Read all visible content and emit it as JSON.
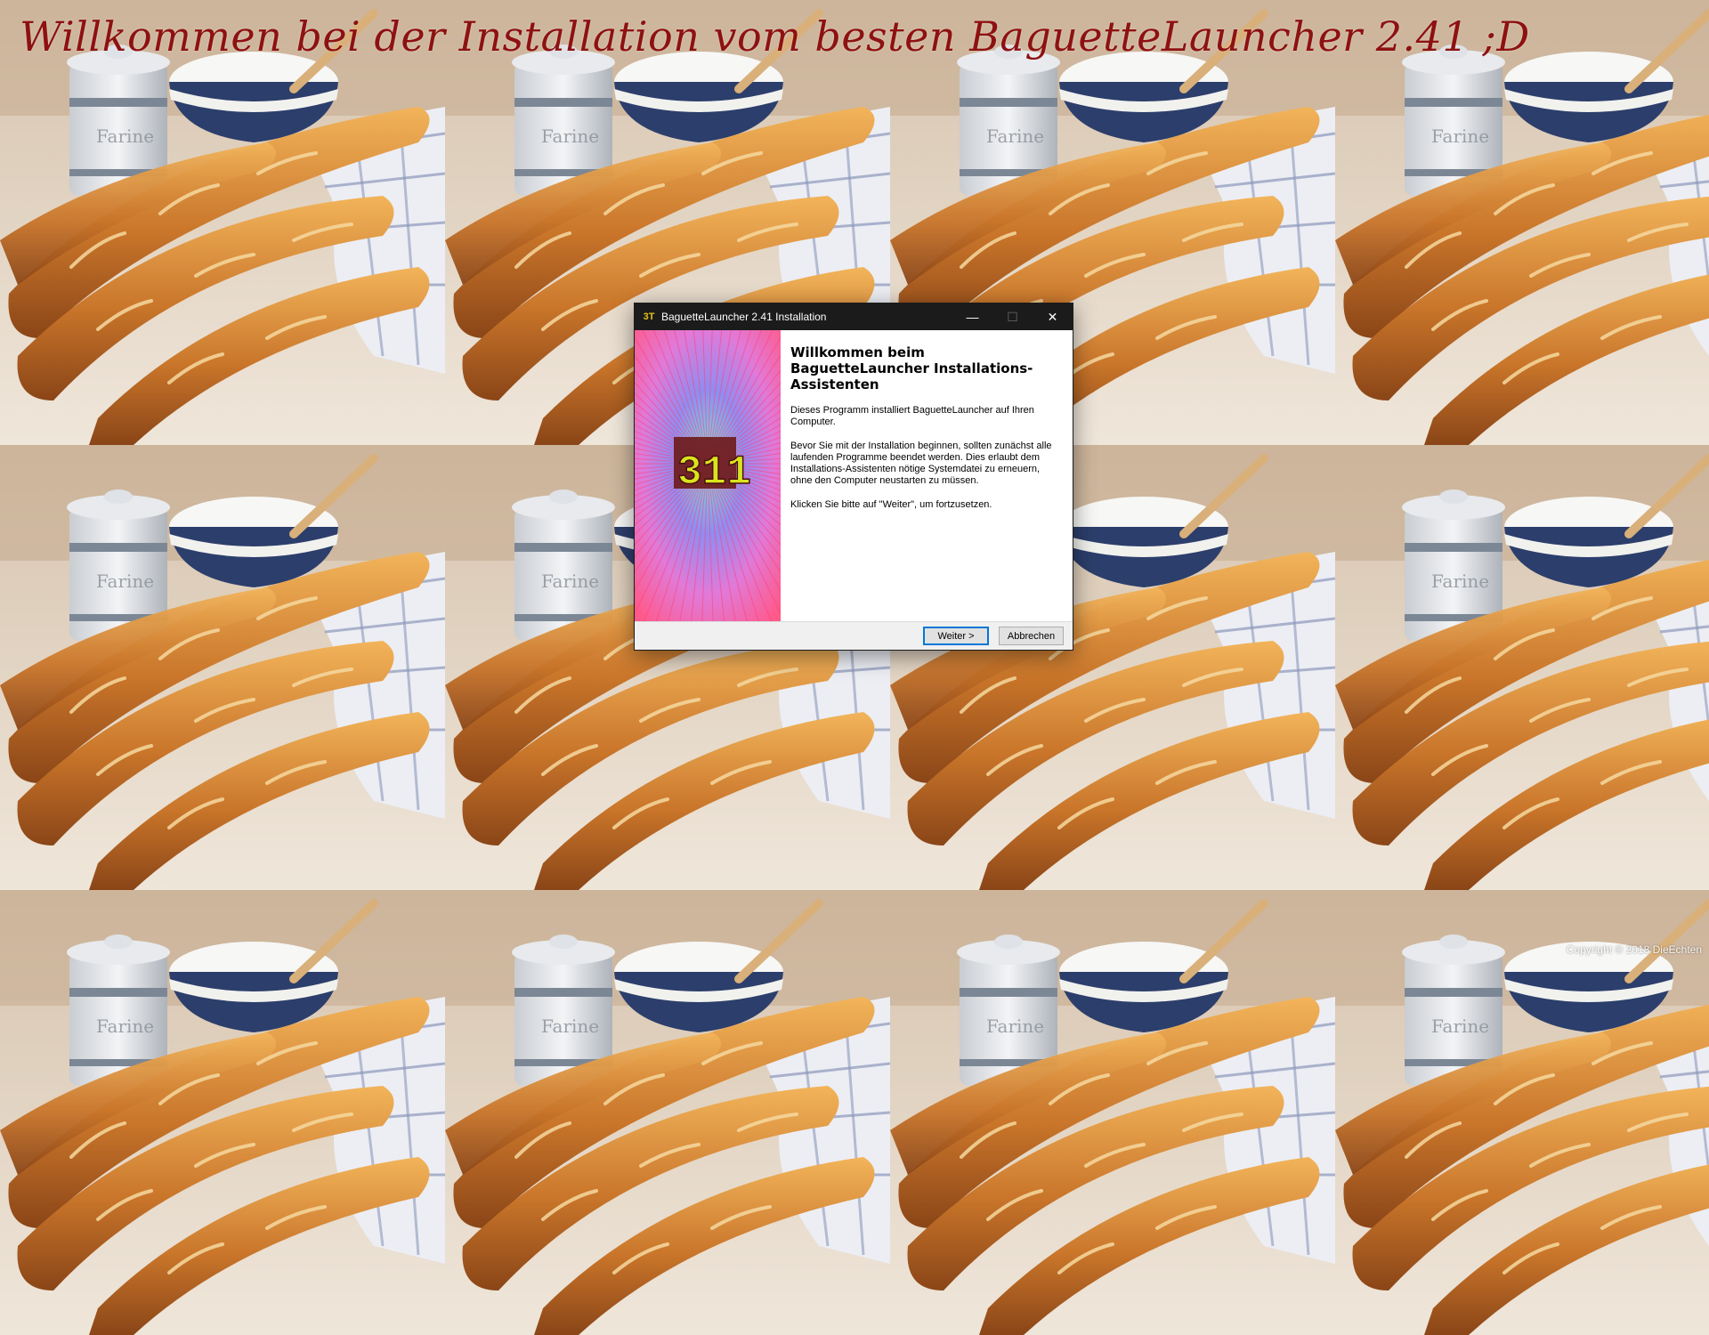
{
  "background": {
    "headline": "Willkommen bei der Installation vom besten BaguetteLauncher 2.41 ;D",
    "jar_label": "Farine",
    "copyright": "Copyright © 2018 DieEchten"
  },
  "window": {
    "title": "BaguetteLauncher 2.41 Installation",
    "icon_label": "3T",
    "controls": {
      "minimize": "—",
      "maximize": "☐",
      "close": "✕"
    },
    "side_image_label": "311",
    "heading": "Willkommen beim BaguetteLauncher Installations-Assistenten",
    "paragraphs": [
      "Dieses Programm installiert BaguetteLauncher auf Ihren Computer.",
      "Bevor Sie mit der Installation beginnen, sollten zunächst alle laufenden Programme beendet werden. Dies erlaubt dem Installations-Assistenten nötige Systemdatei zu erneuern, ohne den Computer neustarten zu müssen.",
      "Klicken Sie bitte auf \"Weiter\", um fortzusetzen."
    ],
    "buttons": {
      "next": "Weiter >",
      "cancel": "Abbrechen"
    }
  },
  "colors": {
    "headline": "#8e1111",
    "titlebar": "#1b1b1b",
    "focus_border": "#0078d7"
  }
}
